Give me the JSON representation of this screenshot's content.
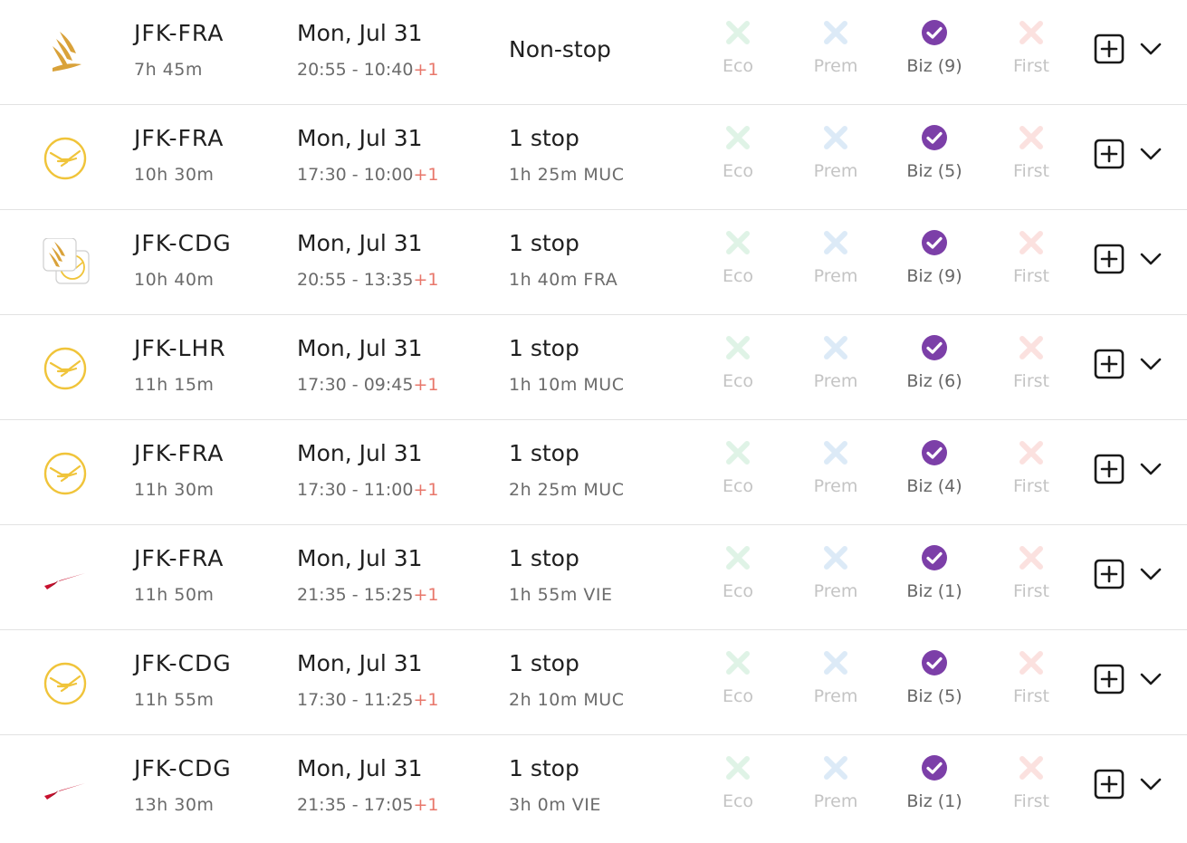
{
  "colors": {
    "eco_x": "#dff3e6",
    "prem_x": "#dceaf7",
    "biz_check": "#7c3fa8",
    "first_x": "#fbe1df",
    "plus_one": "#e8776b",
    "singapore_gold": "#d9a23a",
    "lufthansa_gold": "#f0c43a",
    "austrian_red": "#c8102e"
  },
  "flights": [
    {
      "airline_icon": "singapore-airlines-logo-icon",
      "route": "JFK-FRA",
      "duration": "7h 45m",
      "date": "Mon, Jul 31",
      "times": "20:55 - 10:40",
      "day_offset": "+1",
      "stops": "Non-stop",
      "layover": "",
      "cabins": {
        "eco": "Eco",
        "prem": "Prem",
        "biz": "Biz (9)",
        "first": "First"
      }
    },
    {
      "airline_icon": "lufthansa-logo-icon",
      "route": "JFK-FRA",
      "duration": "10h 30m",
      "date": "Mon, Jul 31",
      "times": "17:30 - 10:00",
      "day_offset": "+1",
      "stops": "1 stop",
      "layover": "1h 25m MUC",
      "cabins": {
        "eco": "Eco",
        "prem": "Prem",
        "biz": "Biz (5)",
        "first": "First"
      }
    },
    {
      "airline_icon": "singapore-lufthansa-combo-logo-icon",
      "route": "JFK-CDG",
      "duration": "10h 40m",
      "date": "Mon, Jul 31",
      "times": "20:55 - 13:35",
      "day_offset": "+1",
      "stops": "1 stop",
      "layover": "1h 40m FRA",
      "cabins": {
        "eco": "Eco",
        "prem": "Prem",
        "biz": "Biz (9)",
        "first": "First"
      }
    },
    {
      "airline_icon": "lufthansa-logo-icon",
      "route": "JFK-LHR",
      "duration": "11h 15m",
      "date": "Mon, Jul 31",
      "times": "17:30 - 09:45",
      "day_offset": "+1",
      "stops": "1 stop",
      "layover": "1h 10m MUC",
      "cabins": {
        "eco": "Eco",
        "prem": "Prem",
        "biz": "Biz (6)",
        "first": "First"
      }
    },
    {
      "airline_icon": "lufthansa-logo-icon",
      "route": "JFK-FRA",
      "duration": "11h 30m",
      "date": "Mon, Jul 31",
      "times": "17:30 - 11:00",
      "day_offset": "+1",
      "stops": "1 stop",
      "layover": "2h 25m MUC",
      "cabins": {
        "eco": "Eco",
        "prem": "Prem",
        "biz": "Biz (4)",
        "first": "First"
      }
    },
    {
      "airline_icon": "austrian-airlines-logo-icon",
      "route": "JFK-FRA",
      "duration": "11h 50m",
      "date": "Mon, Jul 31",
      "times": "21:35 - 15:25",
      "day_offset": "+1",
      "stops": "1 stop",
      "layover": "1h 55m VIE",
      "cabins": {
        "eco": "Eco",
        "prem": "Prem",
        "biz": "Biz (1)",
        "first": "First"
      }
    },
    {
      "airline_icon": "lufthansa-logo-icon",
      "route": "JFK-CDG",
      "duration": "11h 55m",
      "date": "Mon, Jul 31",
      "times": "17:30 - 11:25",
      "day_offset": "+1",
      "stops": "1 stop",
      "layover": "2h 10m MUC",
      "cabins": {
        "eco": "Eco",
        "prem": "Prem",
        "biz": "Biz (5)",
        "first": "First"
      }
    },
    {
      "airline_icon": "austrian-airlines-logo-icon",
      "route": "JFK-CDG",
      "duration": "13h 30m",
      "date": "Mon, Jul 31",
      "times": "21:35 - 17:05",
      "day_offset": "+1",
      "stops": "1 stop",
      "layover": "3h 0m VIE",
      "cabins": {
        "eco": "Eco",
        "prem": "Prem",
        "biz": "Biz (1)",
        "first": "First"
      }
    }
  ],
  "icons": {
    "unavailable": "x-icon",
    "available": "check-circle-icon",
    "add": "plus-square-icon",
    "expand": "chevron-down-icon"
  }
}
